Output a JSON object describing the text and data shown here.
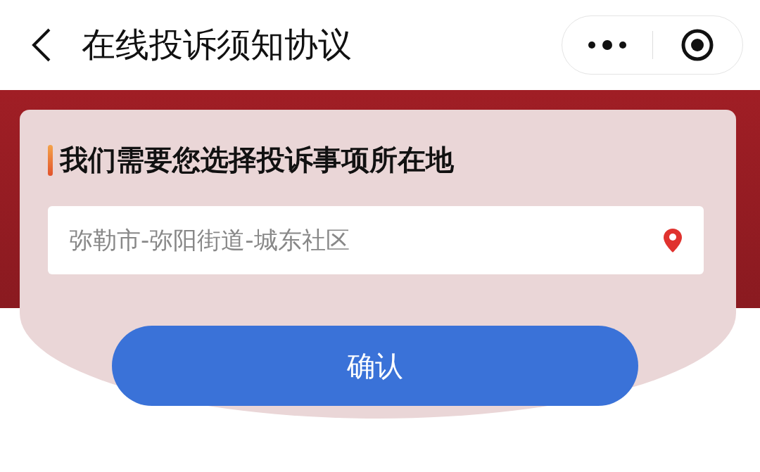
{
  "header": {
    "title": "在线投诉须知协议"
  },
  "card": {
    "heading": "我们需要您选择投诉事项所在地",
    "location_field": {
      "value": "弥勒市-弥阳街道-城东社区"
    },
    "confirm_button": "确认"
  }
}
